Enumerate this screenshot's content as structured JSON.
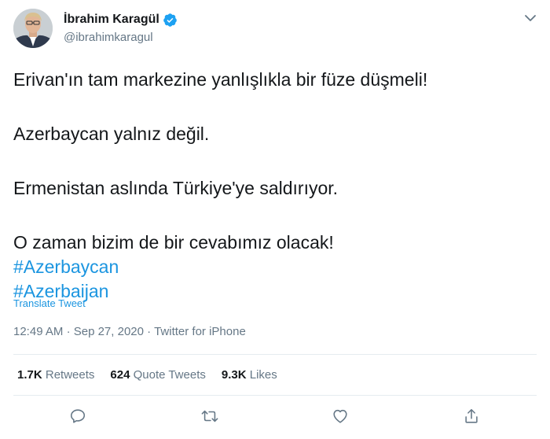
{
  "author": {
    "display_name": "İbrahim Karagül",
    "handle": "@ibrahimkaragul",
    "verified": true
  },
  "tweet": {
    "lines": [
      "Erivan'ın tam markezine yanlışlıkla bir füze düşmeli!",
      "Azerbaycan yalnız değil.",
      "Ermenistan aslında Türkiye'ye saldırıyor.",
      "O zaman bizim de bir cevabımız olacak!"
    ],
    "hashtags": [
      "#Azerbaycan",
      "#Azerbaijan"
    ],
    "translate_label": "Translate Tweet",
    "time": "12:49 AM",
    "date": "Sep 27, 2020",
    "source": "Twitter for iPhone",
    "separator": "·"
  },
  "stats": {
    "retweets_count": "1.7K",
    "retweets_label": "Retweets",
    "quotes_count": "624",
    "quotes_label": "Quote Tweets",
    "likes_count": "9.3K",
    "likes_label": "Likes"
  },
  "colors": {
    "link": "#1b95e0",
    "muted": "#657786",
    "text": "#14171a",
    "divider": "#e6ecf0"
  },
  "icons": {
    "verified": "verified-badge-icon",
    "caret": "chevron-down-icon",
    "reply": "reply-icon",
    "retweet": "retweet-icon",
    "like": "heart-icon",
    "share": "share-icon"
  }
}
